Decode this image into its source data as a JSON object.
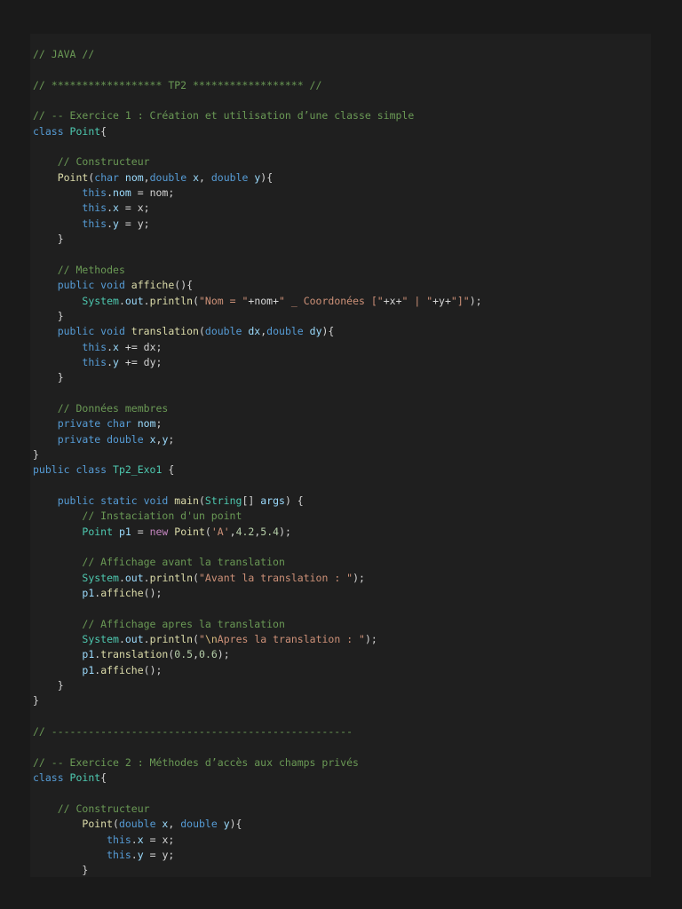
{
  "colors": {
    "background": "#1a1a1a",
    "editor": "#1f1f1f",
    "comment": "#6a9955",
    "keyword": "#569cd6",
    "type": "#4ec9b0",
    "function": "#dcdcaa",
    "variable": "#9cdcfe",
    "string": "#ce9178",
    "number": "#b5cea8",
    "control": "#c586c0",
    "default": "#d4d4d4"
  },
  "code_lines": [
    [
      [
        "c",
        "// JAVA //"
      ]
    ],
    [],
    [
      [
        "c",
        "// ****************** TP2 ****************** //"
      ]
    ],
    [],
    [
      [
        "c",
        "// -- Exercice 1 : Création et utilisation d’une classe simple"
      ]
    ],
    [
      [
        "k",
        "class "
      ],
      [
        "t",
        "Point"
      ],
      [
        "d",
        "{"
      ]
    ],
    [],
    [
      [
        "d",
        "    "
      ],
      [
        "c",
        "// Constructeur"
      ]
    ],
    [
      [
        "d",
        "    "
      ],
      [
        "f",
        "Point"
      ],
      [
        "d",
        "("
      ],
      [
        "k",
        "char "
      ],
      [
        "v",
        "nom"
      ],
      [
        "d",
        ","
      ],
      [
        "k",
        "double "
      ],
      [
        "v",
        "x"
      ],
      [
        "d",
        ", "
      ],
      [
        "k",
        "double "
      ],
      [
        "v",
        "y"
      ],
      [
        "d",
        "){"
      ]
    ],
    [
      [
        "d",
        "        "
      ],
      [
        "k",
        "this"
      ],
      [
        "d",
        "."
      ],
      [
        "v",
        "nom"
      ],
      [
        "d",
        " = nom;"
      ]
    ],
    [
      [
        "d",
        "        "
      ],
      [
        "k",
        "this"
      ],
      [
        "d",
        "."
      ],
      [
        "v",
        "x"
      ],
      [
        "d",
        " = x;"
      ]
    ],
    [
      [
        "d",
        "        "
      ],
      [
        "k",
        "this"
      ],
      [
        "d",
        "."
      ],
      [
        "v",
        "y"
      ],
      [
        "d",
        " = y;"
      ]
    ],
    [
      [
        "d",
        "    }"
      ]
    ],
    [],
    [
      [
        "d",
        "    "
      ],
      [
        "c",
        "// Methodes"
      ]
    ],
    [
      [
        "d",
        "    "
      ],
      [
        "k",
        "public void "
      ],
      [
        "f",
        "affiche"
      ],
      [
        "d",
        "(){"
      ]
    ],
    [
      [
        "d",
        "        "
      ],
      [
        "t",
        "System"
      ],
      [
        "d",
        "."
      ],
      [
        "v",
        "out"
      ],
      [
        "d",
        "."
      ],
      [
        "f",
        "println"
      ],
      [
        "d",
        "("
      ],
      [
        "s",
        "\"Nom = \""
      ],
      [
        "d",
        "+nom+"
      ],
      [
        "s",
        "\" _ Coordonées [\""
      ],
      [
        "d",
        "+x+"
      ],
      [
        "s",
        "\" | \""
      ],
      [
        "d",
        "+y+"
      ],
      [
        "s",
        "\"]\""
      ],
      [
        "d",
        ");"
      ]
    ],
    [
      [
        "d",
        "    }"
      ]
    ],
    [
      [
        "d",
        "    "
      ],
      [
        "k",
        "public void "
      ],
      [
        "f",
        "translation"
      ],
      [
        "d",
        "("
      ],
      [
        "k",
        "double "
      ],
      [
        "v",
        "dx"
      ],
      [
        "d",
        ","
      ],
      [
        "k",
        "double "
      ],
      [
        "v",
        "dy"
      ],
      [
        "d",
        "){"
      ]
    ],
    [
      [
        "d",
        "        "
      ],
      [
        "k",
        "this"
      ],
      [
        "d",
        "."
      ],
      [
        "v",
        "x"
      ],
      [
        "d",
        " += dx;"
      ]
    ],
    [
      [
        "d",
        "        "
      ],
      [
        "k",
        "this"
      ],
      [
        "d",
        "."
      ],
      [
        "v",
        "y"
      ],
      [
        "d",
        " += dy;"
      ]
    ],
    [
      [
        "d",
        "    }"
      ]
    ],
    [],
    [
      [
        "d",
        "    "
      ],
      [
        "c",
        "// Données membres"
      ]
    ],
    [
      [
        "d",
        "    "
      ],
      [
        "k",
        "private char "
      ],
      [
        "v",
        "nom"
      ],
      [
        "d",
        ";"
      ]
    ],
    [
      [
        "d",
        "    "
      ],
      [
        "k",
        "private double "
      ],
      [
        "v",
        "x"
      ],
      [
        "d",
        ","
      ],
      [
        "v",
        "y"
      ],
      [
        "d",
        ";"
      ]
    ],
    [
      [
        "d",
        "}"
      ]
    ],
    [
      [
        "k",
        "public class "
      ],
      [
        "t",
        "Tp2_Exo1"
      ],
      [
        "d",
        " {"
      ]
    ],
    [],
    [
      [
        "d",
        "    "
      ],
      [
        "k",
        "public static void "
      ],
      [
        "f",
        "main"
      ],
      [
        "d",
        "("
      ],
      [
        "t",
        "String"
      ],
      [
        "d",
        "[] "
      ],
      [
        "v",
        "args"
      ],
      [
        "d",
        ") {"
      ]
    ],
    [
      [
        "d",
        "        "
      ],
      [
        "c",
        "// Instaciation d'un point"
      ]
    ],
    [
      [
        "d",
        "        "
      ],
      [
        "t",
        "Point "
      ],
      [
        "v",
        "p1"
      ],
      [
        "d",
        " = "
      ],
      [
        "p",
        "new "
      ],
      [
        "f",
        "Point"
      ],
      [
        "d",
        "("
      ],
      [
        "s",
        "'A'"
      ],
      [
        "d",
        ","
      ],
      [
        "n",
        "4.2"
      ],
      [
        "d",
        ","
      ],
      [
        "n",
        "5.4"
      ],
      [
        "d",
        ");"
      ]
    ],
    [],
    [
      [
        "d",
        "        "
      ],
      [
        "c",
        "// Affichage avant la translation"
      ]
    ],
    [
      [
        "d",
        "        "
      ],
      [
        "t",
        "System"
      ],
      [
        "d",
        "."
      ],
      [
        "v",
        "out"
      ],
      [
        "d",
        "."
      ],
      [
        "f",
        "println"
      ],
      [
        "d",
        "("
      ],
      [
        "s",
        "\"Avant la translation : \""
      ],
      [
        "d",
        ");"
      ]
    ],
    [
      [
        "d",
        "        "
      ],
      [
        "v",
        "p1"
      ],
      [
        "d",
        "."
      ],
      [
        "f",
        "affiche"
      ],
      [
        "d",
        "();"
      ]
    ],
    [],
    [
      [
        "d",
        "        "
      ],
      [
        "c",
        "// Affichage apres la translation"
      ]
    ],
    [
      [
        "d",
        "        "
      ],
      [
        "t",
        "System"
      ],
      [
        "d",
        "."
      ],
      [
        "v",
        "out"
      ],
      [
        "d",
        "."
      ],
      [
        "f",
        "println"
      ],
      [
        "d",
        "("
      ],
      [
        "s",
        "\""
      ],
      [
        "e",
        "\\n"
      ],
      [
        "s",
        "Apres la translation : \""
      ],
      [
        "d",
        ");"
      ]
    ],
    [
      [
        "d",
        "        "
      ],
      [
        "v",
        "p1"
      ],
      [
        "d",
        "."
      ],
      [
        "f",
        "translation"
      ],
      [
        "d",
        "("
      ],
      [
        "n",
        "0.5"
      ],
      [
        "d",
        ","
      ],
      [
        "n",
        "0.6"
      ],
      [
        "d",
        ");"
      ]
    ],
    [
      [
        "d",
        "        "
      ],
      [
        "v",
        "p1"
      ],
      [
        "d",
        "."
      ],
      [
        "f",
        "affiche"
      ],
      [
        "d",
        "();"
      ]
    ],
    [
      [
        "d",
        "    }"
      ]
    ],
    [
      [
        "d",
        "}"
      ]
    ],
    [],
    [
      [
        "c",
        "// -------------------------------------------------"
      ]
    ],
    [],
    [
      [
        "c",
        "// -- Exercice 2 : Méthodes d’accès aux champs privés"
      ]
    ],
    [
      [
        "k",
        "class "
      ],
      [
        "t",
        "Point"
      ],
      [
        "d",
        "{"
      ]
    ],
    [],
    [
      [
        "d",
        "    "
      ],
      [
        "c",
        "// Constructeur"
      ]
    ],
    [
      [
        "d",
        "        "
      ],
      [
        "f",
        "Point"
      ],
      [
        "d",
        "("
      ],
      [
        "k",
        "double "
      ],
      [
        "v",
        "x"
      ],
      [
        "d",
        ", "
      ],
      [
        "k",
        "double "
      ],
      [
        "v",
        "y"
      ],
      [
        "d",
        "){"
      ]
    ],
    [
      [
        "d",
        "            "
      ],
      [
        "k",
        "this"
      ],
      [
        "d",
        "."
      ],
      [
        "v",
        "x"
      ],
      [
        "d",
        " = x;"
      ]
    ],
    [
      [
        "d",
        "            "
      ],
      [
        "k",
        "this"
      ],
      [
        "d",
        "."
      ],
      [
        "v",
        "y"
      ],
      [
        "d",
        " = y;"
      ]
    ],
    [
      [
        "d",
        "        }"
      ]
    ]
  ]
}
